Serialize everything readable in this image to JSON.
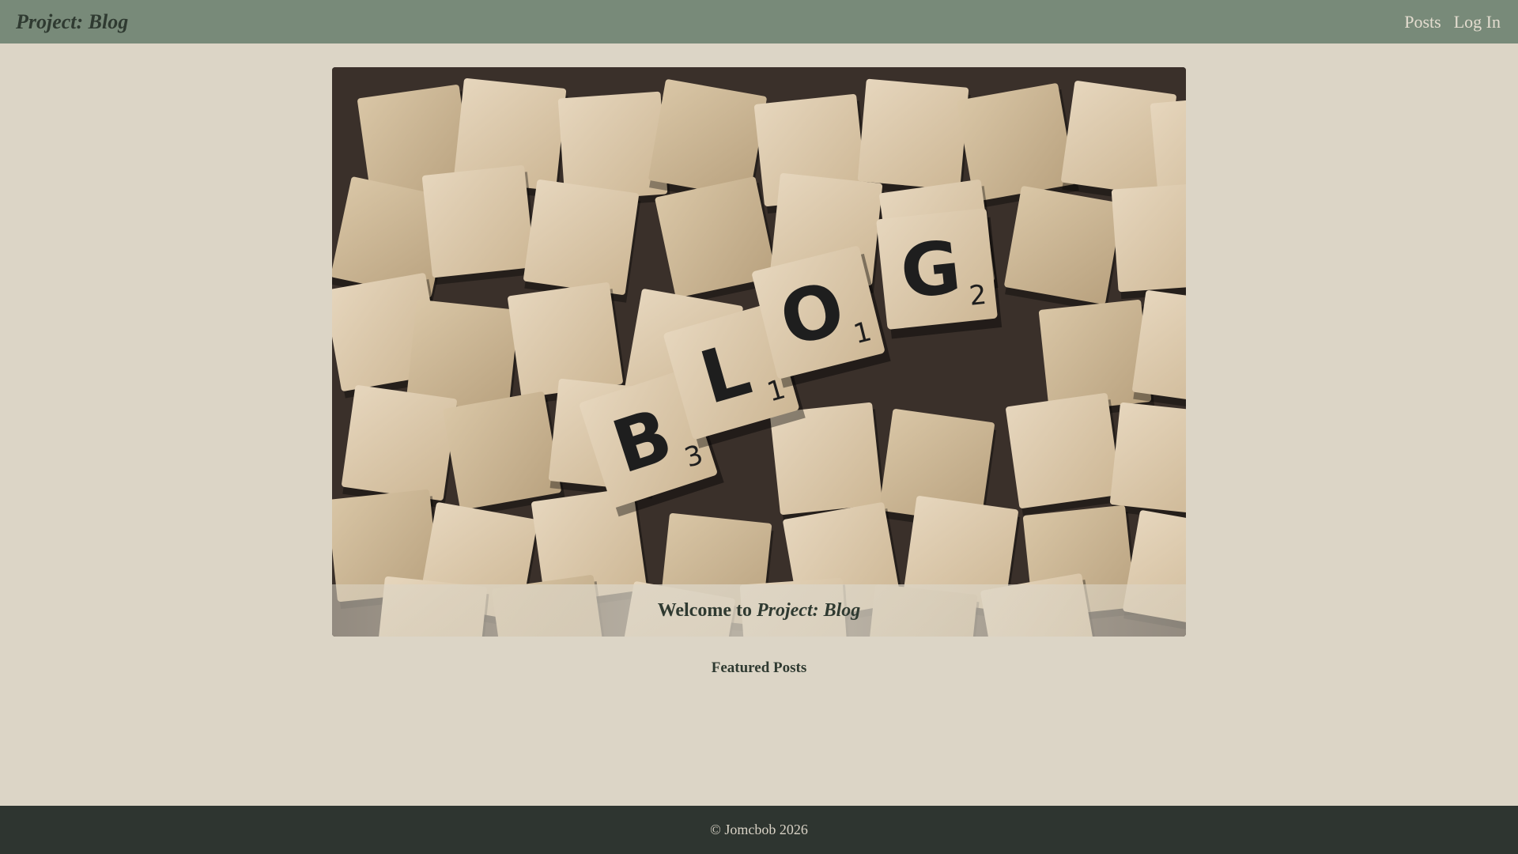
{
  "navbar": {
    "brand": "Project: Blog",
    "links": [
      {
        "label": "Posts"
      },
      {
        "label": "Log In"
      }
    ]
  },
  "hero": {
    "image_alt": "Wooden letter tiles spelling BLOG",
    "tile_letters": [
      "B",
      "L",
      "O",
      "G"
    ],
    "tile_scores": [
      "3",
      "1",
      "1",
      "2"
    ],
    "caption_prefix": "Welcome to",
    "caption_title": "Project: Blog"
  },
  "featured": {
    "heading": "Featured Posts"
  },
  "footer": {
    "copyright": "© Jomcbob 2026"
  },
  "colors": {
    "navbar_bg": "#788a79",
    "page_bg": "#dcd5c6",
    "footer_bg": "#2e3530",
    "brand_text": "#2f3a31",
    "nav_link_text": "#e4ddd0"
  }
}
